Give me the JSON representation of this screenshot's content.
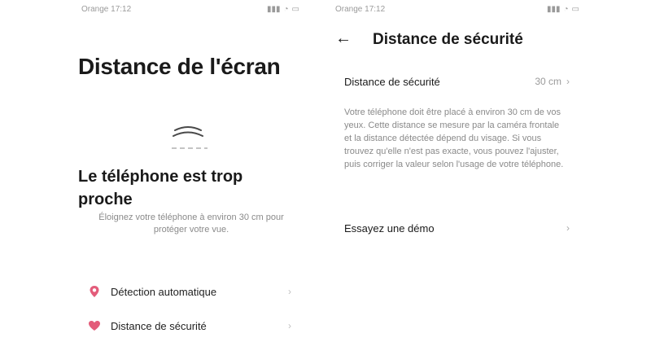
{
  "left_screen": {
    "status_bar": {
      "left_text": "Orange 17:12"
    },
    "title": "Distance de l'écran",
    "heading": "Le téléphone est trop proche",
    "subtext": "Éloignez votre téléphone à environ 30 cm pour protéger votre vue.",
    "menu": [
      {
        "label": "Détection automatique",
        "icon": "location-pin-icon"
      },
      {
        "label": "Distance de sécurité",
        "icon": "heart-icon"
      }
    ]
  },
  "right_screen": {
    "status_bar": {
      "left_text": "Orange 17:12"
    },
    "title": "Distance de sécurité",
    "setting": {
      "label": "Distance de sécurité",
      "value": "30 cm"
    },
    "description": "Votre téléphone doit être placé à environ 30 cm de vos yeux. Cette distance se mesure par la caméra frontale et la distance détectée dépend du visage. Si vous trouvez qu'elle n'est pas exacte, vous pouvez l'ajuster, puis corriger la valeur selon l'usage de votre téléphone.",
    "demo": {
      "label": "Essayez une démo"
    }
  },
  "colors": {
    "text_primary": "#1a1a1a",
    "text_secondary": "#8a8a8a",
    "accent_pink": "#e35c7a",
    "chevron_gray": "#c0c0c0"
  }
}
